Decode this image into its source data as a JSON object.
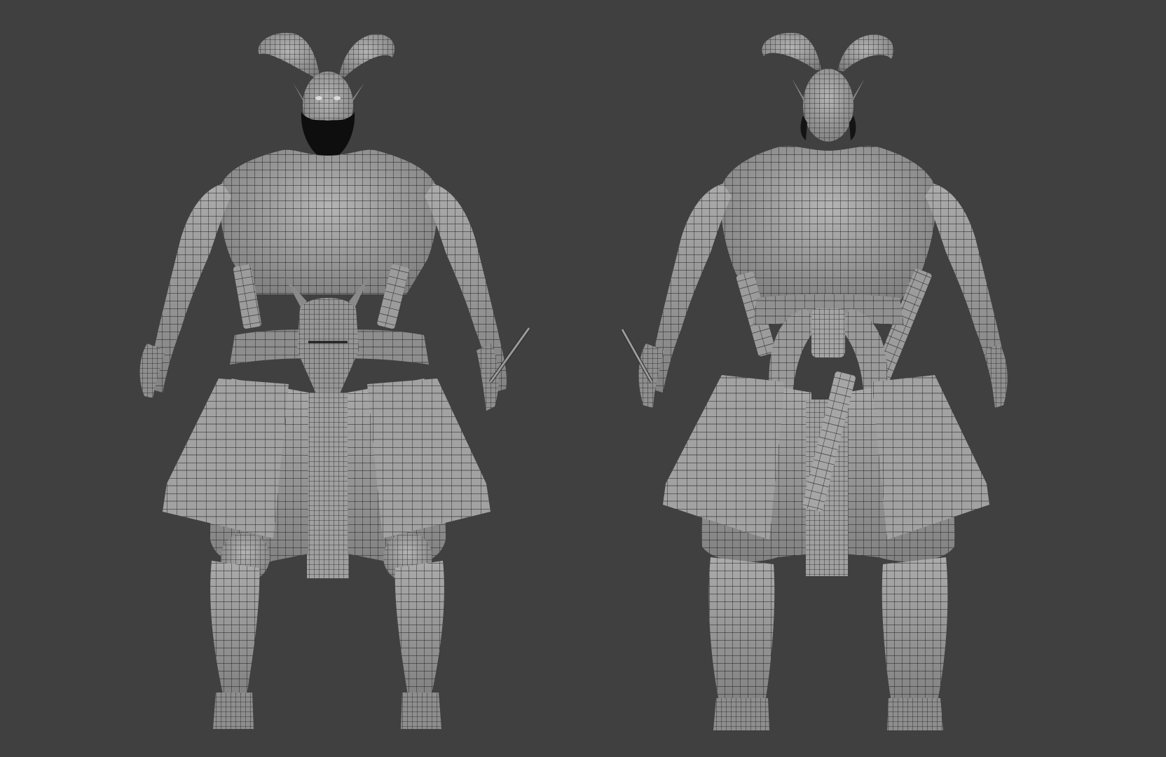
{
  "viewport": {
    "background_color": "#404040",
    "mesh_fill_color": "#9a9a9a",
    "mesh_shade_color": "#7a7a7a",
    "wire_color": "#1a1a1a",
    "beard_color": "#0d0d0d"
  },
  "models": [
    {
      "view": "front",
      "icon": "wireframe-character-front"
    },
    {
      "view": "back",
      "icon": "wireframe-character-back"
    }
  ]
}
